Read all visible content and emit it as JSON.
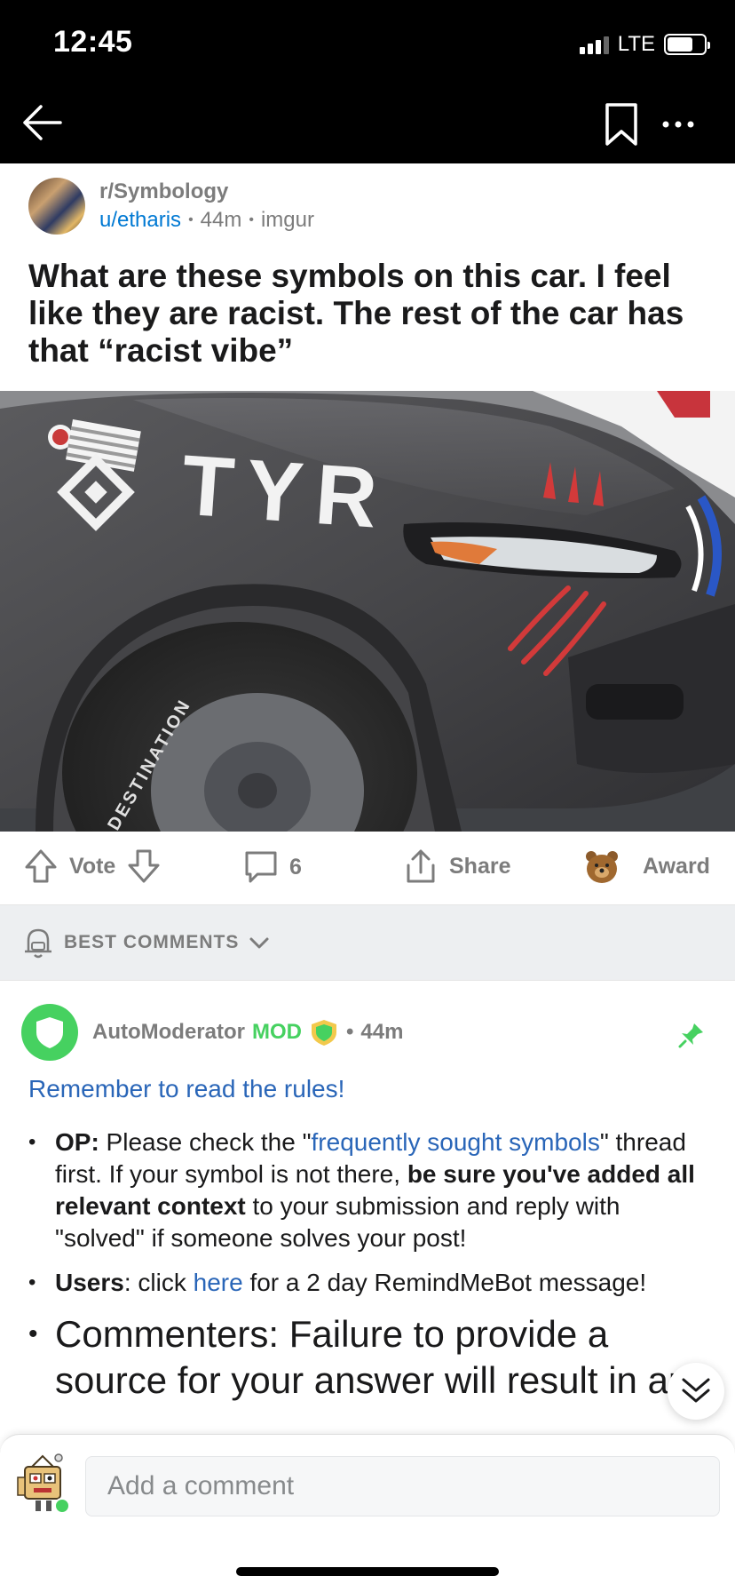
{
  "status_bar": {
    "time": "12:45",
    "network": "LTE"
  },
  "post": {
    "subreddit": "r/Symbology",
    "author": "u/etharis",
    "age": "44m",
    "domain": "imgur",
    "title": "What are these symbols on this car. I feel like they are racist. The rest of the car has that “racist vibe”"
  },
  "image": {
    "decal_text": "TYR",
    "tire_text": "DESTINATION"
  },
  "actions": {
    "vote_label": "Vote",
    "comment_count": "6",
    "share_label": "Share",
    "award_label": "Award"
  },
  "sort": {
    "label": "BEST COMMENTS"
  },
  "comment": {
    "author": "AutoModerator",
    "mod_label": "MOD",
    "age": "44m",
    "rules_link": "Remember to read the rules!",
    "item1": {
      "op_label": "OP:",
      "text_a": " Please check the \"",
      "link": "frequently sought symbols",
      "text_b": "\" thread first. If your symbol is not there, ",
      "bold": "be sure you've added all relevant context",
      "text_c": " to your submission and reply with \"solved\" if someone solves your post!"
    },
    "item2": {
      "users_label": "Users",
      "text_a": ": click ",
      "link": "here",
      "text_b": " for a 2 day RemindMeBot message!"
    },
    "item3": {
      "text": "Commenters: Failure to provide a source for your answer will result in an"
    }
  },
  "composer": {
    "placeholder": "Add a comment"
  },
  "colors": {
    "mod_green": "#46d160",
    "link_blue": "#2a66b8",
    "user_blue": "#0079d3",
    "meta_gray": "#7c7c7c",
    "sort_bg": "#edeff1"
  },
  "icons": [
    "back-arrow-icon",
    "bookmark-icon",
    "more-icon",
    "upvote-icon",
    "downvote-icon",
    "comment-icon",
    "share-icon",
    "award-icon",
    "bell-icon",
    "chevron-down-icon",
    "shield-icon",
    "pin-icon",
    "double-chevron-down-icon"
  ]
}
